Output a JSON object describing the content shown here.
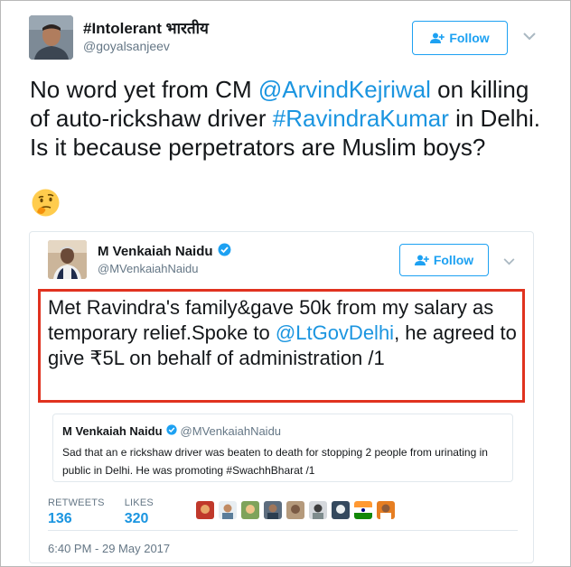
{
  "outer_tweet": {
    "display_name": "#Intolerant भारतीय",
    "handle": "@goyalsanjeev",
    "follow_label": "Follow",
    "text_part1": "No word yet from CM ",
    "mention": "@ArvindKejriwal",
    "text_part2": " on killing of auto-rickshaw driver ",
    "hashtag": "#RavindraKumar",
    "text_part3": " in Delhi.",
    "text_line2": "Is it because perpetrators are Muslim boys?",
    "emoji_icon": "thinking-face-icon"
  },
  "quoted_tweet": {
    "display_name": "M Venkaiah Naidu",
    "handle": "@MVenkaiahNaidu",
    "follow_label": "Follow",
    "verified_icon": "verified-badge-icon",
    "text_part1": "Met Ravindra's family&gave 50k from my salary as temporary relief.Spoke to ",
    "mention": "@LtGovDelhi",
    "text_part2": ", he agreed to give ₹5L on behalf of administration /1",
    "highlight_color": "#e0321f",
    "nested": {
      "display_name": "M Venkaiah Naidu",
      "handle": "@MVenkaiahNaidu",
      "text": "Sad that an e rickshaw driver was beaten to death for stopping 2 people from urinating in public in Delhi. He was promoting #SwachhBharat /1"
    },
    "stats": {
      "retweets_label": "RETWEETS",
      "retweets_value": "136",
      "likes_label": "LIKES",
      "likes_value": "320"
    },
    "timestamp": "6:40 PM - 29 May 2017"
  },
  "colors": {
    "link": "#1b95e0",
    "follow": "#1da1f2",
    "muted": "#657786"
  }
}
